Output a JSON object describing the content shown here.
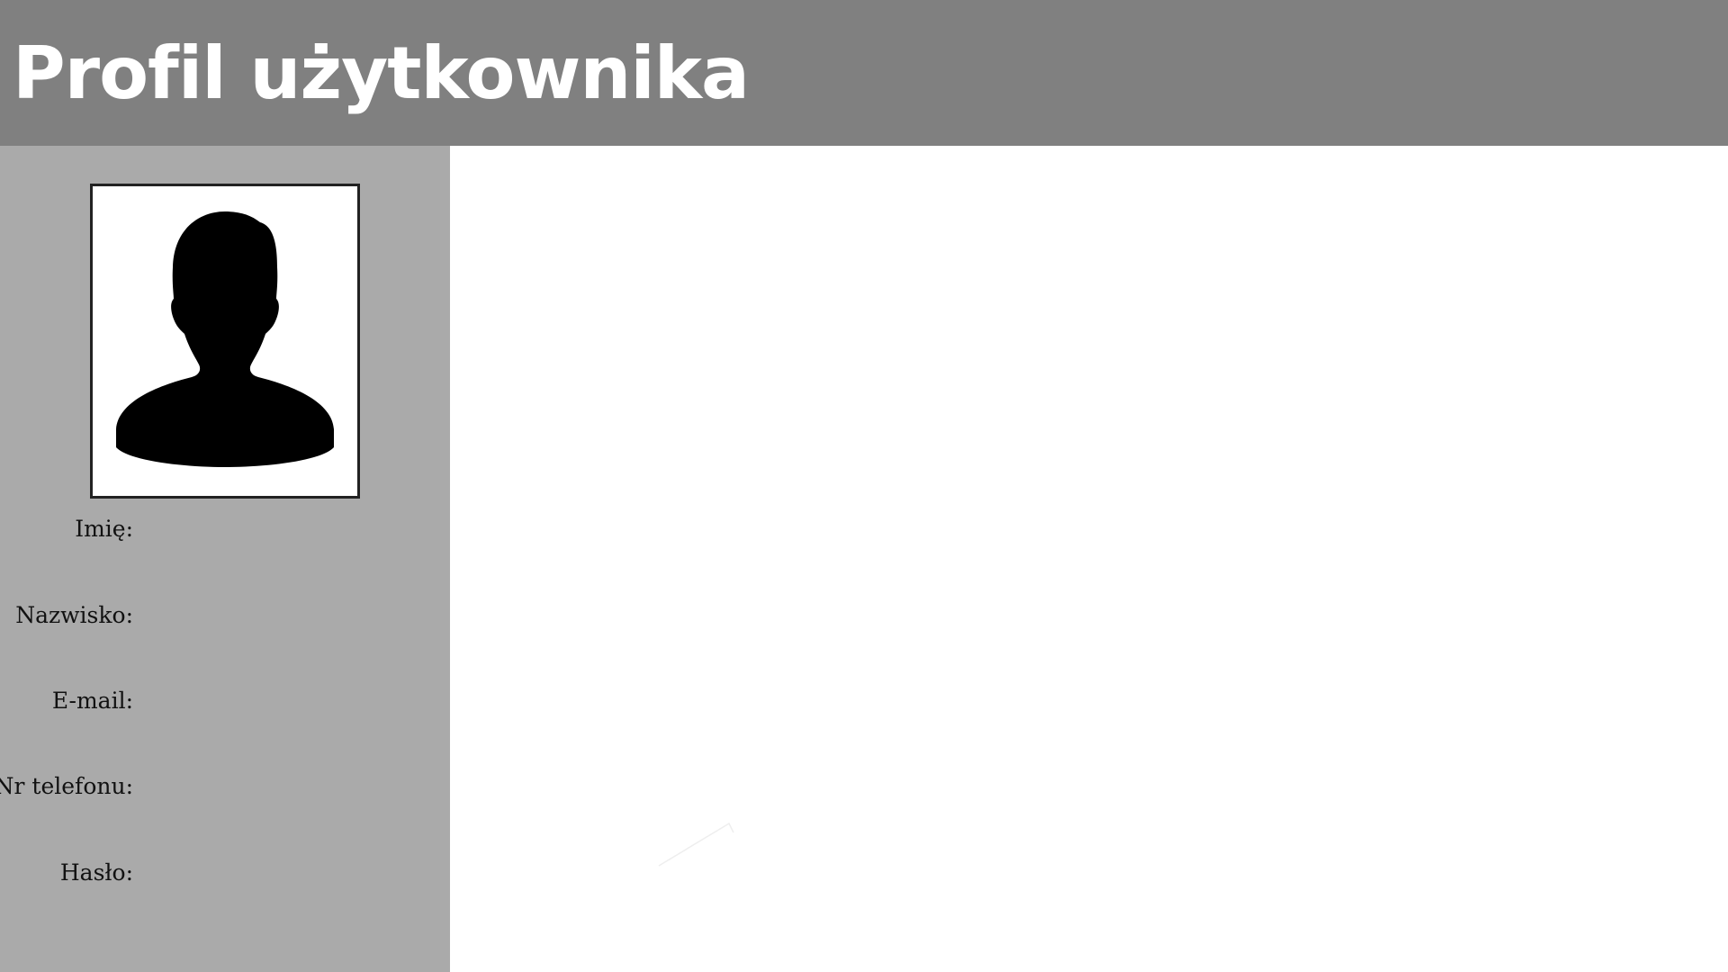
{
  "header": {
    "title": "Profil użytkownika",
    "background_color": "#808080",
    "text_color": "#ffffff"
  },
  "sidebar": {
    "background_color": "#aaaaaa",
    "avatar_icon": "user-silhouette-icon",
    "fields": [
      {
        "label": "Imię:",
        "value": ""
      },
      {
        "label": "Nazwisko:",
        "value": ""
      },
      {
        "label": "E-mail:",
        "value": ""
      },
      {
        "label": "Nr telefonu:",
        "value": ""
      },
      {
        "label": "Hasło:",
        "value": ""
      }
    ]
  },
  "content": {
    "background_color": "#ffffff"
  }
}
